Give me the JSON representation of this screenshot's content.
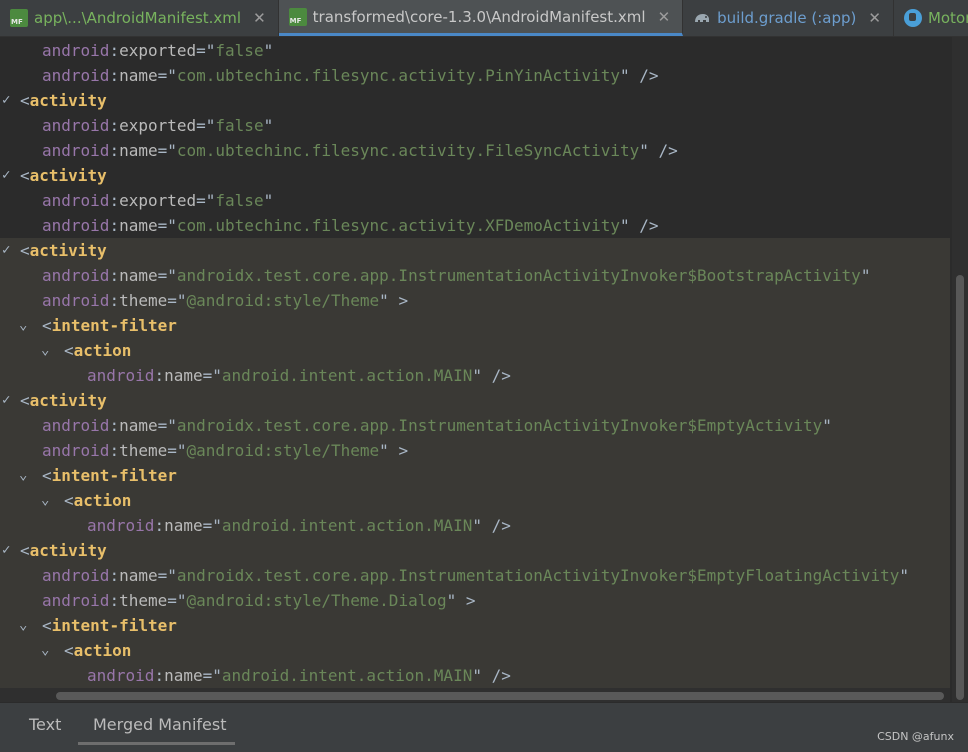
{
  "tabs": [
    {
      "label": "app\\...\\AndroidManifest.xml",
      "icon": "manifest-file-icon",
      "color": "#78b35e",
      "close": "✕"
    },
    {
      "label": "transformed\\core-1.3.0\\AndroidManifest.xml",
      "icon": "manifest-file-icon",
      "color": "#c8c8c8",
      "close": "✕"
    },
    {
      "label": "build.gradle (:app)",
      "icon": "gradle-elephant-icon",
      "color": "#6d9ecf",
      "close": "✕"
    },
    {
      "label": "MotorMar",
      "icon": "kotlin-class-icon",
      "color": "#78b35e"
    }
  ],
  "editor": {
    "lines": [
      {
        "fold": "",
        "indent": 1,
        "tokens": [
          [
            "ns",
            "android"
          ],
          [
            "p",
            ":"
          ],
          [
            "at",
            "exported"
          ],
          [
            "p",
            "=\""
          ],
          [
            "s",
            "false"
          ],
          [
            "p",
            "\""
          ]
        ]
      },
      {
        "fold": "",
        "indent": 1,
        "tokens": [
          [
            "ns",
            "android"
          ],
          [
            "p",
            ":"
          ],
          [
            "at",
            "name"
          ],
          [
            "p",
            "=\""
          ],
          [
            "s",
            "com.ubtechinc.filesync.activity.PinYinActivity"
          ],
          [
            "p",
            "\" />"
          ]
        ]
      },
      {
        "fold": "✓",
        "indent": 0,
        "tokens": [
          [
            "p",
            "<"
          ],
          [
            "b",
            "activity"
          ]
        ]
      },
      {
        "fold": "",
        "indent": 1,
        "tokens": [
          [
            "ns",
            "android"
          ],
          [
            "p",
            ":"
          ],
          [
            "at",
            "exported"
          ],
          [
            "p",
            "=\""
          ],
          [
            "s",
            "false"
          ],
          [
            "p",
            "\""
          ]
        ]
      },
      {
        "fold": "",
        "indent": 1,
        "tokens": [
          [
            "ns",
            "android"
          ],
          [
            "p",
            ":"
          ],
          [
            "at",
            "name"
          ],
          [
            "p",
            "=\""
          ],
          [
            "s",
            "com.ubtechinc.filesync.activity.FileSyncActivity"
          ],
          [
            "p",
            "\" />"
          ]
        ]
      },
      {
        "fold": "✓",
        "indent": 0,
        "tokens": [
          [
            "p",
            "<"
          ],
          [
            "b",
            "activity"
          ]
        ]
      },
      {
        "fold": "",
        "indent": 1,
        "tokens": [
          [
            "ns",
            "android"
          ],
          [
            "p",
            ":"
          ],
          [
            "at",
            "exported"
          ],
          [
            "p",
            "=\""
          ],
          [
            "s",
            "false"
          ],
          [
            "p",
            "\""
          ]
        ]
      },
      {
        "fold": "",
        "indent": 1,
        "tokens": [
          [
            "ns",
            "android"
          ],
          [
            "p",
            ":"
          ],
          [
            "at",
            "name"
          ],
          [
            "p",
            "=\""
          ],
          [
            "s",
            "com.ubtechinc.filesync.activity.XFDemoActivity"
          ],
          [
            "p",
            "\" />"
          ]
        ]
      },
      {
        "fold": "✓",
        "indent": 0,
        "tokens": [
          [
            "p",
            "<"
          ],
          [
            "b",
            "activity"
          ]
        ]
      },
      {
        "fold": "",
        "indent": 1,
        "tokens": [
          [
            "ns",
            "android"
          ],
          [
            "p",
            ":"
          ],
          [
            "at",
            "name"
          ],
          [
            "p",
            "=\""
          ],
          [
            "s",
            "androidx.test.core.app.InstrumentationActivityInvoker$BootstrapActivity"
          ],
          [
            "p",
            "\""
          ]
        ]
      },
      {
        "fold": "",
        "indent": 1,
        "tokens": [
          [
            "ns",
            "android"
          ],
          [
            "p",
            ":"
          ],
          [
            "at",
            "theme"
          ],
          [
            "p",
            "=\""
          ],
          [
            "s",
            "@android:style/Theme"
          ],
          [
            "p",
            "\" >"
          ]
        ]
      },
      {
        "fold": "⌄",
        "indent": 1,
        "tokens": [
          [
            "p",
            "<"
          ],
          [
            "b",
            "intent-filter"
          ]
        ]
      },
      {
        "fold": "⌄",
        "indent": 2,
        "tokens": [
          [
            "p",
            "<"
          ],
          [
            "b",
            "action"
          ]
        ]
      },
      {
        "fold": "",
        "indent": 3,
        "tokens": [
          [
            "ns",
            "android"
          ],
          [
            "p",
            ":"
          ],
          [
            "at",
            "name"
          ],
          [
            "p",
            "=\""
          ],
          [
            "s",
            "android.intent.action.MAIN"
          ],
          [
            "p",
            "\" />"
          ]
        ]
      },
      {
        "fold": "✓",
        "indent": 0,
        "tokens": [
          [
            "p",
            "<"
          ],
          [
            "b",
            "activity"
          ]
        ]
      },
      {
        "fold": "",
        "indent": 1,
        "tokens": [
          [
            "ns",
            "android"
          ],
          [
            "p",
            ":"
          ],
          [
            "at",
            "name"
          ],
          [
            "p",
            "=\""
          ],
          [
            "s",
            "androidx.test.core.app.InstrumentationActivityInvoker$EmptyActivity"
          ],
          [
            "p",
            "\""
          ]
        ]
      },
      {
        "fold": "",
        "indent": 1,
        "tokens": [
          [
            "ns",
            "android"
          ],
          [
            "p",
            ":"
          ],
          [
            "at",
            "theme"
          ],
          [
            "p",
            "=\""
          ],
          [
            "s",
            "@android:style/Theme"
          ],
          [
            "p",
            "\" >"
          ]
        ]
      },
      {
        "fold": "⌄",
        "indent": 1,
        "tokens": [
          [
            "p",
            "<"
          ],
          [
            "b",
            "intent-filter"
          ]
        ]
      },
      {
        "fold": "⌄",
        "indent": 2,
        "tokens": [
          [
            "p",
            "<"
          ],
          [
            "b",
            "action"
          ]
        ]
      },
      {
        "fold": "",
        "indent": 3,
        "tokens": [
          [
            "ns",
            "android"
          ],
          [
            "p",
            ":"
          ],
          [
            "at",
            "name"
          ],
          [
            "p",
            "=\""
          ],
          [
            "s",
            "android.intent.action.MAIN"
          ],
          [
            "p",
            "\" />"
          ]
        ]
      },
      {
        "fold": "✓",
        "indent": 0,
        "tokens": [
          [
            "p",
            "<"
          ],
          [
            "b",
            "activity"
          ]
        ]
      },
      {
        "fold": "",
        "indent": 1,
        "tokens": [
          [
            "ns",
            "android"
          ],
          [
            "p",
            ":"
          ],
          [
            "at",
            "name"
          ],
          [
            "p",
            "=\""
          ],
          [
            "s",
            "androidx.test.core.app.InstrumentationActivityInvoker$EmptyFloatingActivity"
          ],
          [
            "p",
            "\""
          ]
        ]
      },
      {
        "fold": "",
        "indent": 1,
        "tokens": [
          [
            "ns",
            "android"
          ],
          [
            "p",
            ":"
          ],
          [
            "at",
            "theme"
          ],
          [
            "p",
            "=\""
          ],
          [
            "s",
            "@android:style/Theme.Dialog"
          ],
          [
            "p",
            "\" >"
          ]
        ]
      },
      {
        "fold": "⌄",
        "indent": 1,
        "tokens": [
          [
            "p",
            "<"
          ],
          [
            "b",
            "intent-filter"
          ]
        ]
      },
      {
        "fold": "⌄",
        "indent": 2,
        "tokens": [
          [
            "p",
            "<"
          ],
          [
            "b",
            "action"
          ]
        ]
      },
      {
        "fold": "",
        "indent": 3,
        "tokens": [
          [
            "ns",
            "android"
          ],
          [
            "p",
            ":"
          ],
          [
            "at",
            "name"
          ],
          [
            "p",
            "=\""
          ],
          [
            "s",
            "android.intent.action.MAIN"
          ],
          [
            "p",
            "\" />"
          ]
        ]
      }
    ]
  },
  "bottom_tabs": {
    "text_label": "Text",
    "merged_label": "Merged Manifest"
  },
  "watermark": "CSDN @afunx"
}
